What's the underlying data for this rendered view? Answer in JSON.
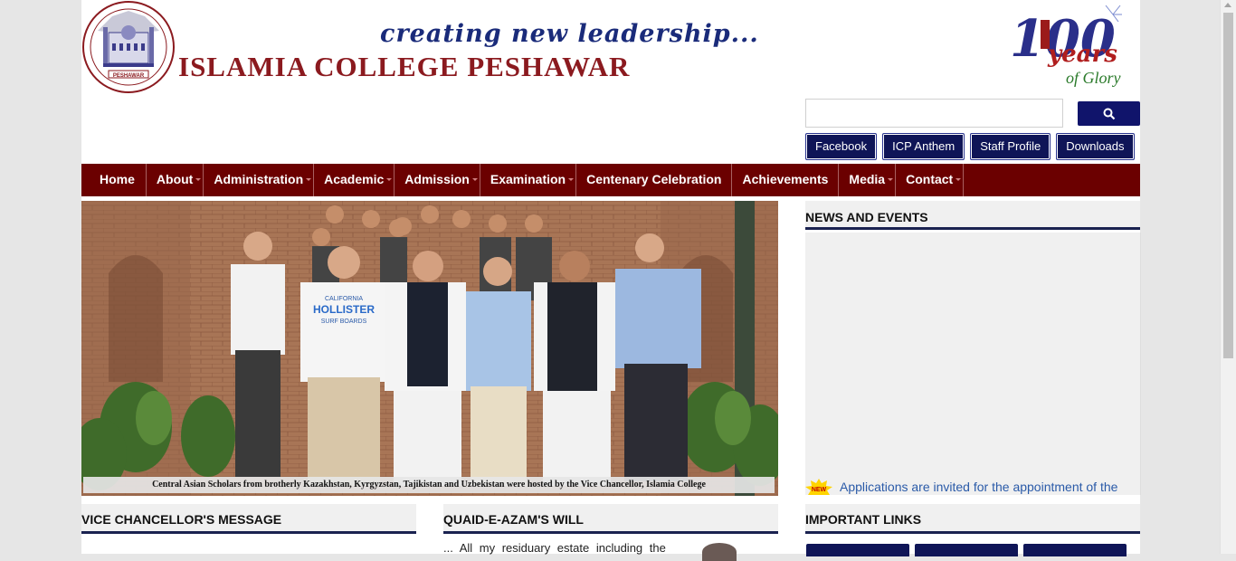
{
  "header": {
    "tagline": "creating new leadership...",
    "college_name": "ISLAMIA COLLEGE  PESHAWAR",
    "logo_text": "PESHAWAR",
    "centenary_logo": {
      "number": "100",
      "line1": "years",
      "line2": "of Glory"
    }
  },
  "search": {
    "placeholder": "",
    "button_icon": "search-icon"
  },
  "quick_links": [
    "Facebook",
    "ICP Anthem",
    "Staff Profile",
    "Downloads"
  ],
  "nav": [
    {
      "label": "Home",
      "dropdown": false
    },
    {
      "label": "About",
      "dropdown": true
    },
    {
      "label": "Administration",
      "dropdown": true
    },
    {
      "label": "Academic",
      "dropdown": true
    },
    {
      "label": "Admission",
      "dropdown": true
    },
    {
      "label": "Examination",
      "dropdown": true
    },
    {
      "label": "Centenary Celebration",
      "dropdown": false
    },
    {
      "label": "Achievements",
      "dropdown": false
    },
    {
      "label": "Media",
      "dropdown": true
    },
    {
      "label": "Contact",
      "dropdown": true
    }
  ],
  "slider": {
    "caption": "Central Asian Scholars from brotherly Kazakhstan, Kyrgyzstan, Tajikistan and Uzbekistan were hosted by the Vice Chancellor, Islamia College",
    "shirt_text_1": "CALIFORNIA",
    "shirt_text_2": "HOLLISTER",
    "shirt_text_3": "SURF BOARDS"
  },
  "news": {
    "title": "NEWS AND EVENTS",
    "badge": "NEW",
    "items": [
      "Applications are invited for the appointment of the"
    ]
  },
  "sections": {
    "vc_title": "VICE CHANCELLOR'S MESSAGE",
    "qa_title": "QUAID-E-AZAM'S WILL",
    "qa_text": "... All my residuary estate including the",
    "il_title": "IMPORTANT LINKS"
  },
  "colors": {
    "nav_bg": "#6b0000",
    "quick_link_bg": "#0f1557",
    "college_name": "#8b1a1f",
    "tagline": "#1a2b7a",
    "news_link": "#2a5aa8"
  }
}
